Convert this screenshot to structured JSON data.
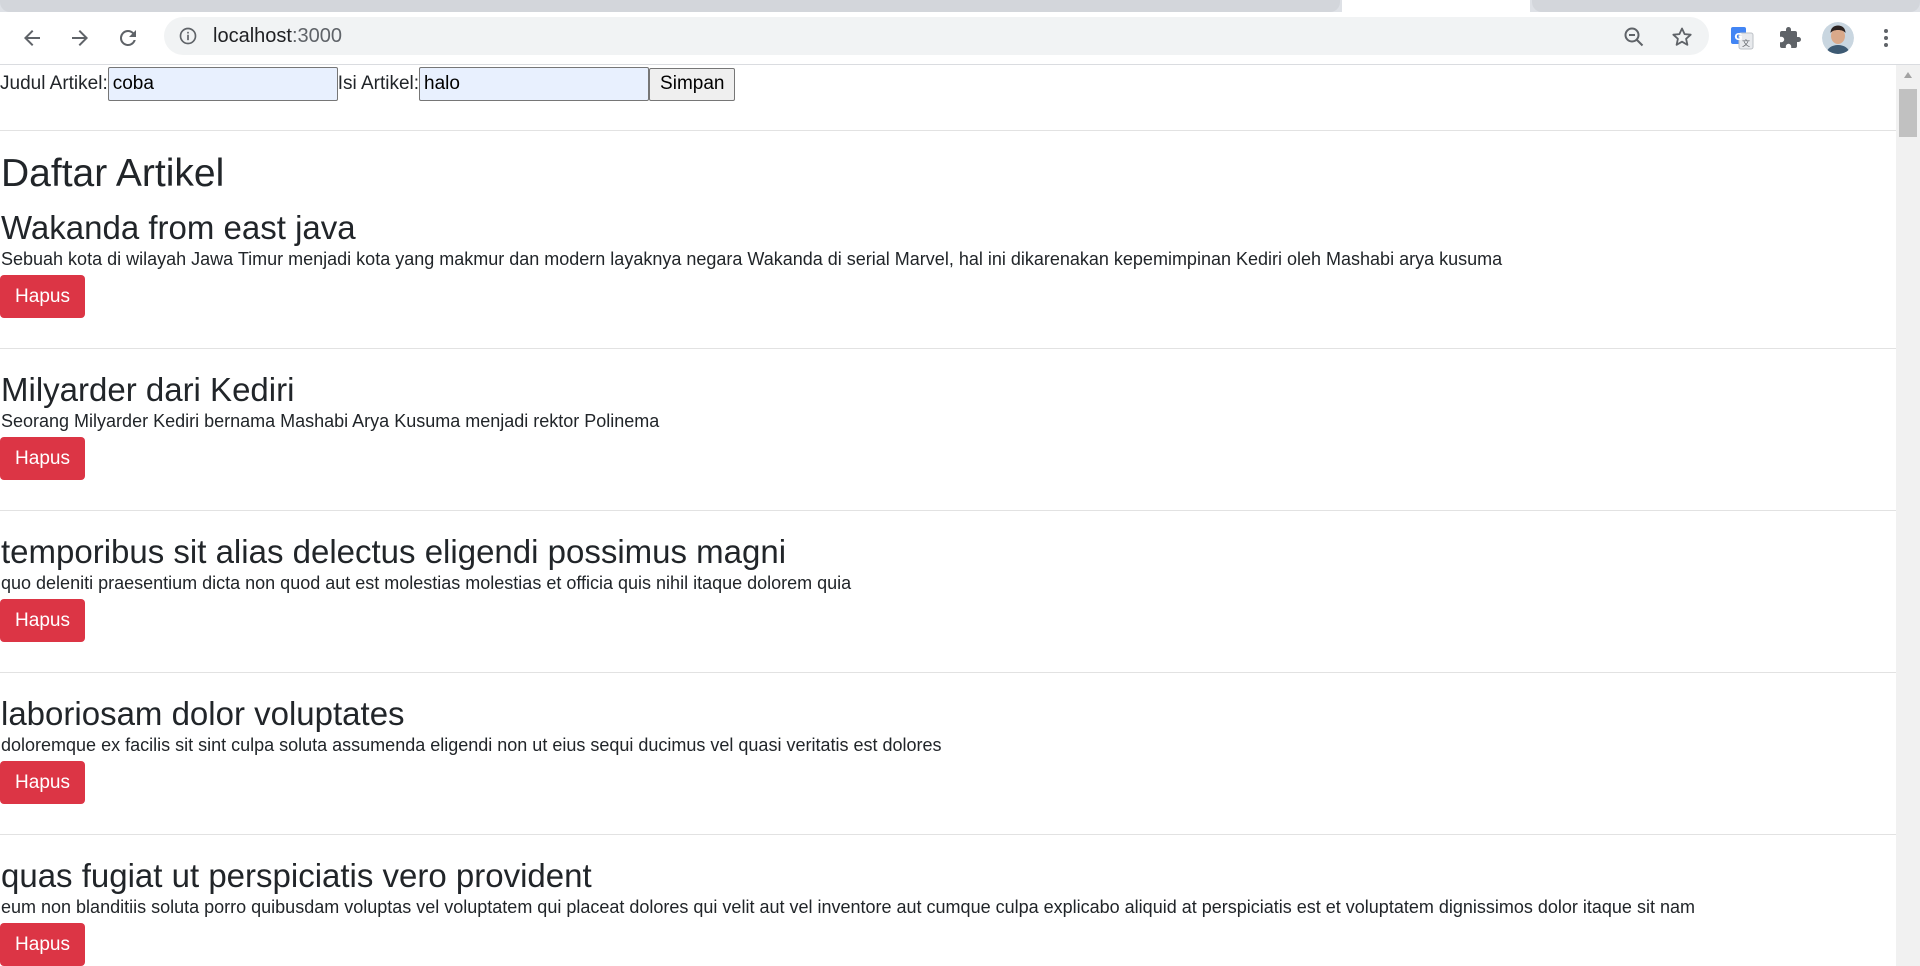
{
  "browser": {
    "url_host": "localhost",
    "url_port": ":3000",
    "icons": {
      "back": "back-arrow-icon",
      "forward": "forward-arrow-icon",
      "reload": "reload-icon",
      "site_info": "info-icon",
      "zoom": "zoom-out-icon",
      "bookmark": "star-icon",
      "translate": "translate-extension-icon",
      "extensions": "puzzle-icon",
      "menu": "kebab-menu-icon"
    }
  },
  "form": {
    "title_label": "Judul Artikel:",
    "title_value": "coba",
    "content_label": "Isi Artikel:",
    "content_value": "halo",
    "submit_label": "Simpan"
  },
  "page_title": "Daftar Artikel",
  "articles": [
    {
      "title": "Wakanda from east java",
      "body": "Sebuah kota di wilayah Jawa Timur menjadi kota yang makmur dan modern layaknya negara Wakanda di serial Marvel, hal ini dikarenakan kepemimpinan Kediri oleh Mashabi arya kusuma",
      "delete_label": "Hapus"
    },
    {
      "title": "Milyarder dari Kediri",
      "body": "Seorang Milyarder Kediri bernama Mashabi Arya Kusuma menjadi rektor Polinema",
      "delete_label": "Hapus"
    },
    {
      "title": "temporibus sit alias delectus eligendi possimus magni",
      "body": "quo deleniti praesentium dicta non quod aut est molestias molestias et officia quis nihil itaque dolorem quia",
      "delete_label": "Hapus"
    },
    {
      "title": "laboriosam dolor voluptates",
      "body": "doloremque ex facilis sit sint culpa soluta assumenda eligendi non ut eius sequi ducimus vel quasi veritatis est dolores",
      "delete_label": "Hapus"
    },
    {
      "title": "quas fugiat ut perspiciatis vero provident",
      "body": "eum non blanditiis soluta porro quibusdam voluptas vel voluptatem qui placeat dolores qui velit aut vel inventore aut cumque culpa explicabo aliquid at perspiciatis est et voluptatem dignissimos dolor itaque sit nam",
      "delete_label": "Hapus"
    }
  ],
  "colors": {
    "danger": "#dc3545",
    "autofill_input": "#e8f0fe",
    "text": "#212529"
  }
}
